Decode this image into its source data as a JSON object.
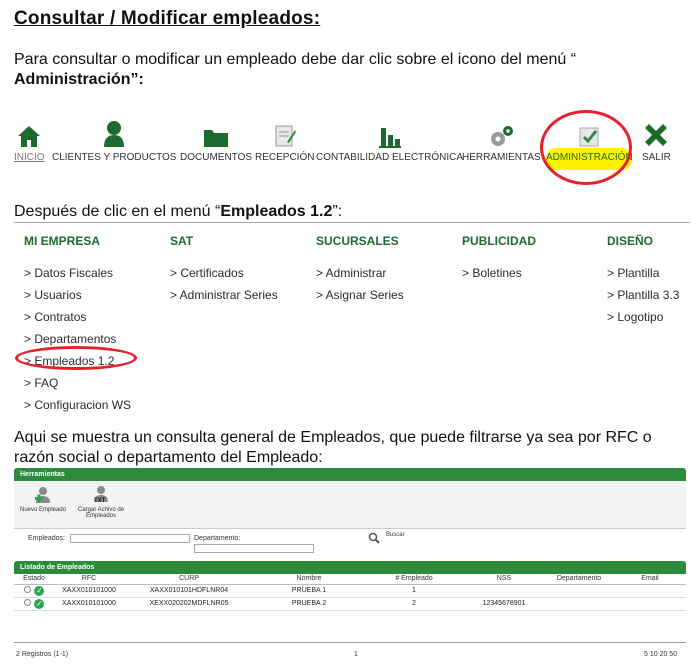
{
  "doc": {
    "title": "Consultar / Modificar empleados:",
    "intro_pre": "Para consultar o modificar un empleado debe dar clic sobre el icono del menú “",
    "intro_bold": "Administración",
    "intro_post": "”:",
    "step2_pre": "Después de clic en el menú “",
    "step2_bold": "Empleados 1.2",
    "step2_post": "”:",
    "step3": "Aqui se muestra un consulta general de Empleados, que puede filtrarse ya sea por RFC o razón social o departamento del Empleado:"
  },
  "topnav": [
    {
      "label": "INICIO",
      "icon": "home-icon"
    },
    {
      "label": "CLIENTES Y PRODUCTOS",
      "icon": "user-icon"
    },
    {
      "label": "DOCUMENTOS",
      "icon": "folder-icon"
    },
    {
      "label": "RECEPCIÓN",
      "icon": "clipboard-icon"
    },
    {
      "label": "CONTABILIDAD ELECTRÓNICA",
      "icon": "bar-chart-icon"
    },
    {
      "label": "HERRAMIENTAS",
      "icon": "gears-icon"
    },
    {
      "label": "ADMINISTRACIÓN",
      "icon": "folder-check-icon"
    },
    {
      "label": "SALIR",
      "icon": "exit-x-icon"
    }
  ],
  "menu": [
    {
      "head": "MI EMPRESA",
      "items": [
        "> Datos Fiscales",
        "> Usuarios",
        "> Contratos",
        "> Departamentos",
        "> Empleados 1.2",
        "> FAQ",
        "> Configuracion WS"
      ]
    },
    {
      "head": "SAT",
      "items": [
        "> Certificados",
        "> Administrar Series"
      ]
    },
    {
      "head": "SUCURSALES",
      "items": [
        "> Administrar",
        "> Asignar Series"
      ]
    },
    {
      "head": "PUBLICIDAD",
      "items": [
        "> Boletines"
      ]
    },
    {
      "head": "DISEÑO",
      "items": [
        "> Plantilla",
        "> Plantilla 3.3",
        "> Logotipo"
      ]
    }
  ],
  "panel": {
    "tools_title": "Herramientas",
    "tool_new": "Nuevo Empleado",
    "tool_upload_1": "Cargar Achivo de",
    "tool_upload_2": "Empleados",
    "filter_emp": "Empleados:",
    "filter_dept": "Departamento:",
    "search": "Buscar",
    "list_title": "Listado de Empleados",
    "columns": [
      "Estado",
      "RFC",
      "CURP",
      "Nombre",
      "# Empleado",
      "NSS",
      "Departamento",
      "Email"
    ],
    "rows": [
      {
        "rfc": "XAXX010101000",
        "curp": "XAXX010101HDFLNR04",
        "nombre": "PRUEBA 1",
        "num": "1",
        "nss": "",
        "dept": "",
        "email": ""
      },
      {
        "rfc": "XAXX010101000",
        "curp": "XEXX020202MDFLNR05",
        "nombre": "PRUEBA 2",
        "num": "2",
        "nss": "12345678901",
        "dept": "",
        "email": ""
      }
    ],
    "footer_count": "2 Registros (1-1)",
    "footer_page": "1",
    "footer_sizes": "5  10  20  50"
  }
}
